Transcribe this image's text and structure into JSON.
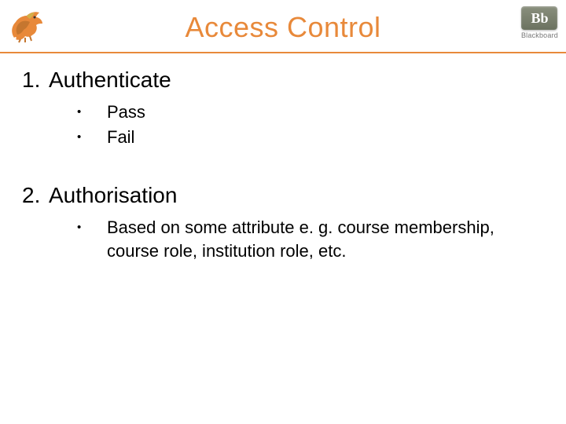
{
  "header": {
    "title": "Access Control",
    "bb_box": "Bb",
    "bb_label": "Blackboard"
  },
  "items": [
    {
      "number": "1.",
      "title": "Authenticate",
      "sub": [
        {
          "text": "Pass"
        },
        {
          "text": "Fail"
        }
      ]
    },
    {
      "number": "2.",
      "title": "Authorisation",
      "sub": [
        {
          "text": "Based on some attribute e. g. course membership, course role, institution role, etc."
        }
      ]
    }
  ]
}
